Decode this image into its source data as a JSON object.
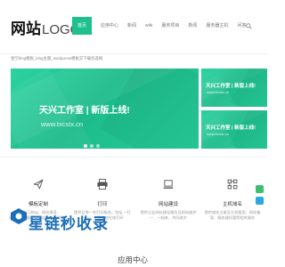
{
  "header": {
    "logo_cn": "网站",
    "logo_en": "LOGO",
    "nav": [
      {
        "label": "首页",
        "active": true
      },
      {
        "label": "应用中心",
        "active": false
      },
      {
        "label": "新闻",
        "active": false
      },
      {
        "label": "wiki",
        "active": false
      },
      {
        "label": "服务项目",
        "active": false
      },
      {
        "label": "新闻",
        "active": false
      },
      {
        "label": "服务器主机",
        "active": false
      },
      {
        "label": "问答",
        "active": false
      }
    ]
  },
  "tagline": "星空blog模板_blog主题_wordpress模板交下载优选网",
  "slider": {
    "title": "天兴工作室 | 新版上线!",
    "url": "www.txcstx.cn"
  },
  "side_banners": [
    {
      "title": "天兴工作室 | 新版上线!",
      "url": "www.txcstx.cn"
    },
    {
      "title": "天兴工作室 | 新版上线!",
      "url": "www.txcstx.cn"
    }
  ],
  "features": [
    {
      "icon": "paper-plane-icon",
      "title": "模板定制",
      "desc": "基础学习blog、网站建设、wordpress模板及网站定制开发服务"
    },
    {
      "icon": "printer-icon",
      "title": "打印",
      "desc": "提供日常一些打印服务，包括 一打一 一、在线文档在线打印"
    },
    {
      "icon": "laptop-icon",
      "title": "网站建设",
      "desc": "提供企业网站建设服务及网站维护 一、一起来，共同进步"
    },
    {
      "icon": "server-icon",
      "title": "主机域名",
      "desc": "提供域名注册及主机租用、网站备案、服务器托管等相关服务"
    }
  ],
  "section_title": "应用中心",
  "watermark": "星链秒收录",
  "colors": {
    "accent": "#1ec08e",
    "watermark": "#1b6fb8"
  }
}
